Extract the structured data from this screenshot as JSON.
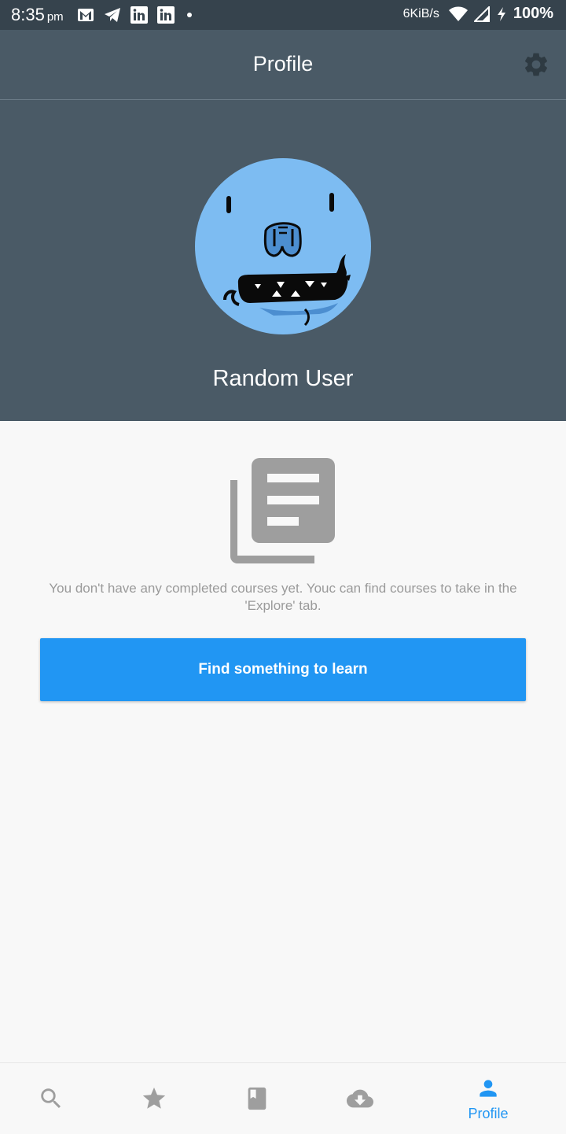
{
  "status_bar": {
    "time": "8:35",
    "ampm": "pm",
    "net_speed": "6KiB/s",
    "battery": "100%",
    "notification_icons": [
      "gmail-icon",
      "telegram-icon",
      "linkedin-icon",
      "linkedin-icon",
      "dot-icon"
    ]
  },
  "appbar": {
    "title": "Profile",
    "settings_icon": "gear-icon"
  },
  "profile": {
    "name": "Random User"
  },
  "empty_state": {
    "icon": "library-books-icon",
    "message": "You don't have any completed courses yet. Youc can find courses to take in the 'Explore' tab.",
    "button_label": "Find something to learn"
  },
  "bottom_nav": {
    "items": [
      {
        "icon": "search-icon",
        "label": ""
      },
      {
        "icon": "star-icon",
        "label": ""
      },
      {
        "icon": "book-icon",
        "label": ""
      },
      {
        "icon": "cloud-download-icon",
        "label": ""
      },
      {
        "icon": "person-icon",
        "label": "Profile",
        "active": true
      }
    ]
  },
  "colors": {
    "status_bar": "#36434d",
    "header": "#4a5a66",
    "accent": "#2196f3",
    "avatar_bg": "#7dbcf2",
    "icon_grey": "#9e9e9e"
  }
}
